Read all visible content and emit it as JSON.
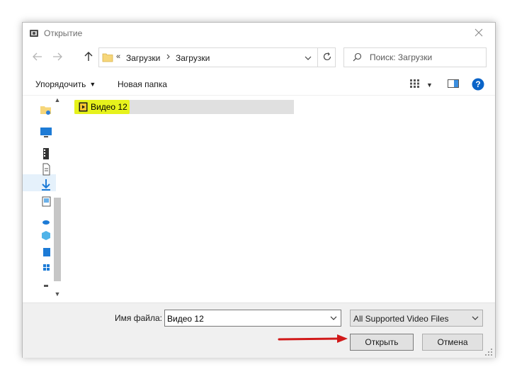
{
  "window": {
    "title": "Открытие"
  },
  "address": {
    "overflow": "«",
    "crumbs": [
      "Загрузки",
      "Загрузки"
    ]
  },
  "search": {
    "placeholder": "Поиск: Загрузки"
  },
  "toolbar": {
    "organize_label": "Упорядочить",
    "new_folder_label": "Новая папка"
  },
  "files": [
    {
      "name": "Видео 12",
      "type": "video"
    }
  ],
  "bottom": {
    "filename_label": "Имя файла:",
    "filename_value": "Видео 12",
    "filetype_value": "All Supported Video Files",
    "open_label": "Открыть",
    "cancel_label": "Отмена"
  },
  "colors": {
    "highlight": "#e6f21c",
    "selection": "#e0e0e0",
    "accent": "#0078d7",
    "annotation_arrow": "#d11a1a"
  }
}
